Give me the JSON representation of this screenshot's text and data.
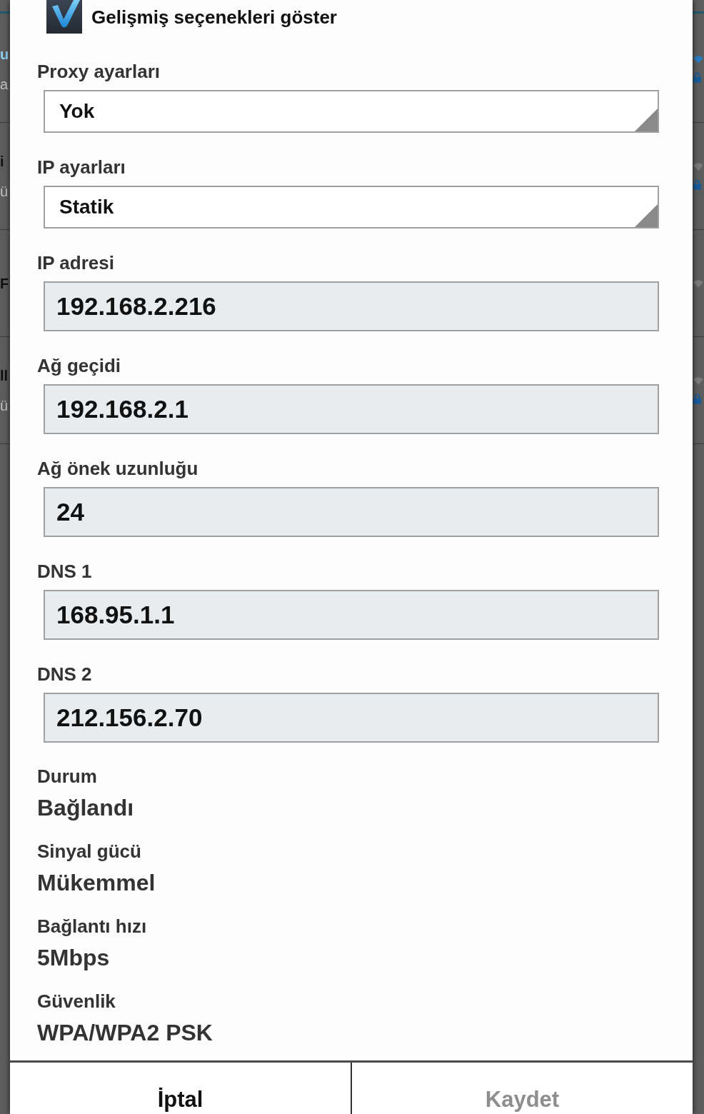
{
  "background_list": {
    "rows": [
      {
        "title": "u",
        "subtitle": "a",
        "connected": true,
        "secured": true
      },
      {
        "title": "i",
        "subtitle": "ü",
        "connected": false,
        "secured": true
      },
      {
        "title": "F",
        "connected": false,
        "secured": false
      },
      {
        "title": "ll",
        "subtitle": "ü",
        "connected": false,
        "secured": true
      }
    ]
  },
  "dialog": {
    "advanced_options": {
      "label": "Gelişmiş seçenekleri göster",
      "checked": true
    },
    "fields": [
      {
        "kind": "dropdown",
        "label": "Proxy ayarları",
        "value": "Yok"
      },
      {
        "kind": "dropdown",
        "label": "IP ayarları",
        "value": "Statik"
      },
      {
        "kind": "text",
        "label": "IP adresi",
        "value": "192.168.2.216"
      },
      {
        "kind": "text",
        "label": "Ağ geçidi",
        "value": "192.168.2.1"
      },
      {
        "kind": "text",
        "label": "Ağ önek uzunluğu",
        "value": "24"
      },
      {
        "kind": "text",
        "label": "DNS 1",
        "value": "168.95.1.1"
      },
      {
        "kind": "text",
        "label": "DNS 2",
        "value": "212.156.2.70"
      }
    ],
    "details": [
      {
        "label": "Durum",
        "value": "Bağlandı"
      },
      {
        "label": "Sinyal gücü",
        "value": "Mükemmel"
      },
      {
        "label": "Bağlantı hızı",
        "value": "5Mbps"
      },
      {
        "label": "Güvenlik",
        "value": "WPA/WPA2 PSK"
      }
    ],
    "buttons": [
      {
        "label": "İptal",
        "disabled": false
      },
      {
        "label": "Kaydet",
        "disabled": true
      }
    ]
  }
}
